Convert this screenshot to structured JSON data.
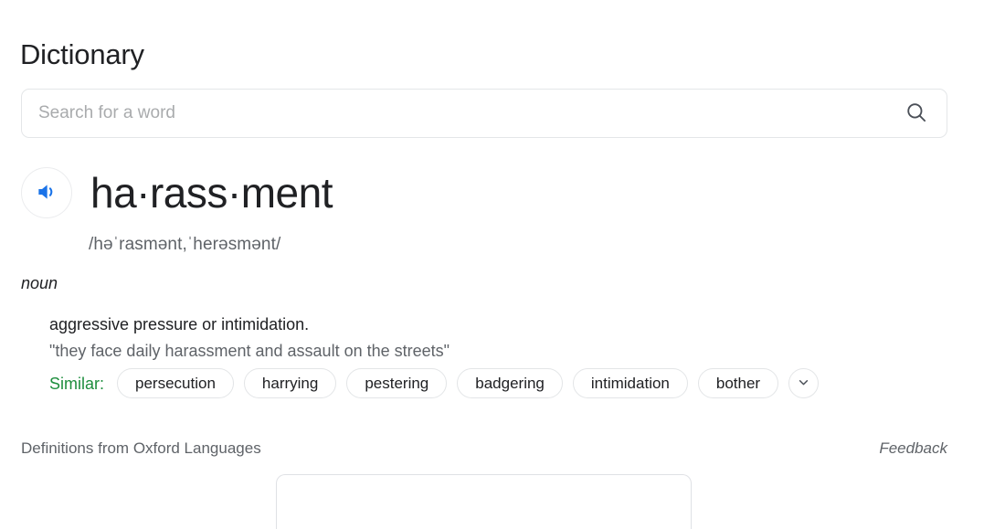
{
  "page": {
    "title": "Dictionary"
  },
  "search": {
    "placeholder": "Search for a word",
    "value": "",
    "icon": "search-icon"
  },
  "entry": {
    "audio_icon": "speaker-icon",
    "headword": "ha·rass·ment",
    "phonetic": "/həˈrasmənt,ˈherəsmənt/",
    "part_of_speech": "noun",
    "definition": "aggressive pressure or intimidation.",
    "example": "\"they face daily harassment and assault on the streets\"",
    "similar": {
      "label": "Similar:",
      "label_color": "#1e8e3e",
      "chips": [
        "persecution",
        "harrying",
        "pestering",
        "badgering",
        "intimidation",
        "bother"
      ],
      "expand_icon": "chevron-down-icon"
    }
  },
  "footer": {
    "source": "Definitions from Oxford Languages",
    "feedback": "Feedback"
  },
  "colors": {
    "audio_blue": "#1a73e8",
    "text_primary": "#202124",
    "text_secondary": "#5f6368",
    "border": "#e3e5e7"
  }
}
